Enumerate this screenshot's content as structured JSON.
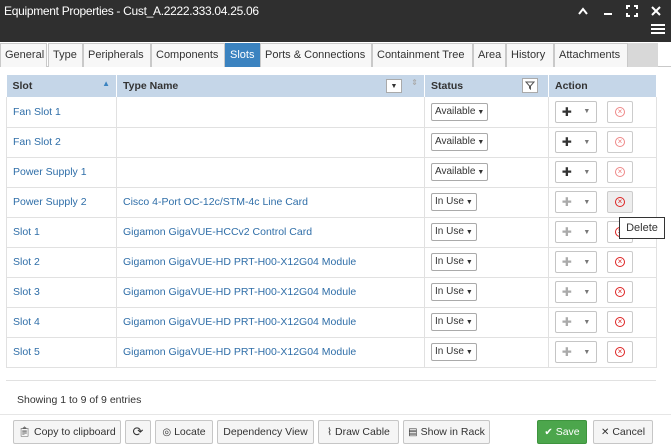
{
  "window": {
    "title": "Equipment Properties - Cust_A.2222.333.04.25.06"
  },
  "tabs": [
    {
      "label": "General"
    },
    {
      "label": "Type"
    },
    {
      "label": "Peripherals"
    },
    {
      "label": "Components"
    },
    {
      "label": "Slots"
    },
    {
      "label": "Ports & Connections"
    },
    {
      "label": "Containment Tree"
    },
    {
      "label": "Area"
    },
    {
      "label": "History"
    },
    {
      "label": "Attachments"
    }
  ],
  "active_tab": "Slots",
  "table": {
    "headers": {
      "slot": "Slot",
      "type_name": "Type Name",
      "status": "Status",
      "action": "Action"
    },
    "rows": [
      {
        "slot": "Fan Slot 1",
        "type_name": "",
        "status": "Available",
        "add_enabled": true,
        "delete_enabled": false
      },
      {
        "slot": "Fan Slot 2",
        "type_name": "",
        "status": "Available",
        "add_enabled": true,
        "delete_enabled": false
      },
      {
        "slot": "Power Supply 1",
        "type_name": "",
        "status": "Available",
        "add_enabled": true,
        "delete_enabled": false
      },
      {
        "slot": "Power Supply 2",
        "type_name": "Cisco 4-Port OC-12c/STM-4c Line Card",
        "status": "In Use",
        "add_enabled": false,
        "delete_enabled": true
      },
      {
        "slot": "Slot 1",
        "type_name": "Gigamon GigaVUE-HCCv2 Control Card",
        "status": "In Use",
        "add_enabled": false,
        "delete_enabled": true
      },
      {
        "slot": "Slot 2",
        "type_name": "Gigamon GigaVUE-HD PRT-H00-X12G04 Module",
        "status": "In Use",
        "add_enabled": false,
        "delete_enabled": true
      },
      {
        "slot": "Slot 3",
        "type_name": "Gigamon GigaVUE-HD PRT-H00-X12G04 Module",
        "status": "In Use",
        "add_enabled": false,
        "delete_enabled": true
      },
      {
        "slot": "Slot 4",
        "type_name": "Gigamon GigaVUE-HD PRT-H00-X12G04 Module",
        "status": "In Use",
        "add_enabled": false,
        "delete_enabled": true
      },
      {
        "slot": "Slot 5",
        "type_name": "Gigamon GigaVUE-HD PRT-H00-X12G04 Module",
        "status": "In Use",
        "add_enabled": false,
        "delete_enabled": true
      }
    ]
  },
  "tooltip": {
    "text": "Delete"
  },
  "info": {
    "text": "Showing 1 to 9 of 9 entries"
  },
  "footer": {
    "copy_label": "Copy to clipboard",
    "locate_label": "Locate",
    "dependency_label": "Dependency View",
    "draw_cable_label": "Draw Cable",
    "show_in_rack_label": "Show in Rack",
    "save_label": "Save",
    "cancel_label": "Cancel"
  },
  "colors": {
    "titlebar": "#2f2f2f",
    "active_tab": "#3b83c0",
    "header_bg": "#c5d6e8",
    "link": "#2f6ea8",
    "save": "#4ca64c"
  }
}
